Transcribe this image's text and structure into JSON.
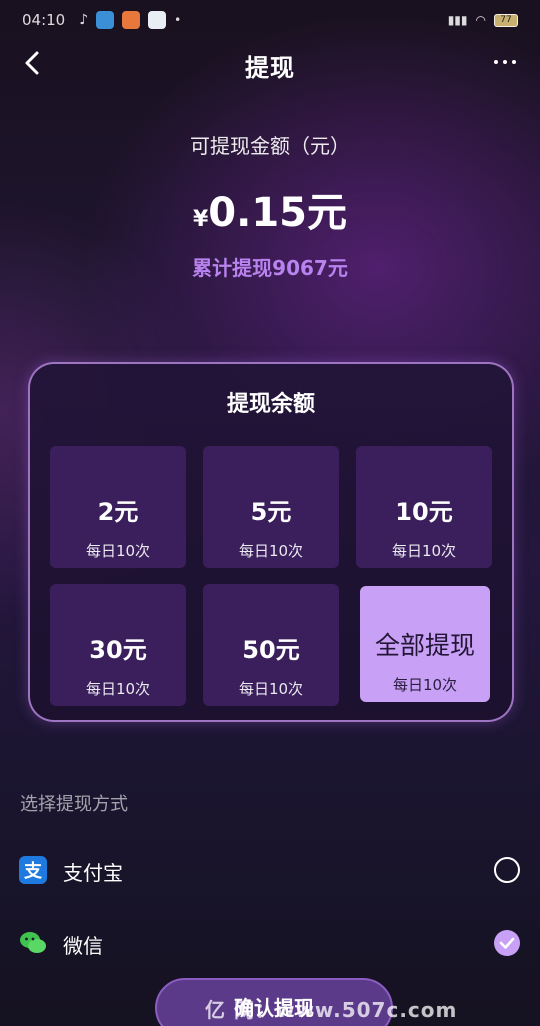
{
  "status_bar": {
    "time": "04:10",
    "battery": "77"
  },
  "nav": {
    "title": "提现"
  },
  "balance": {
    "label": "可提现金额（元）",
    "currency": "¥",
    "amount": "0.15元",
    "total_withdrawn": "累计提现9067元"
  },
  "card": {
    "title": "提现余额",
    "options": [
      {
        "amount": "2元",
        "limit": "每日10次"
      },
      {
        "amount": "5元",
        "limit": "每日10次"
      },
      {
        "amount": "10元",
        "limit": "每日10次"
      },
      {
        "amount": "30元",
        "limit": "每日10次"
      },
      {
        "amount": "50元",
        "limit": "每日10次"
      },
      {
        "amount": "全部提现",
        "limit": "每日10次"
      }
    ]
  },
  "methods": {
    "header": "选择提现方式",
    "items": [
      {
        "label": "支付宝",
        "checked": false
      },
      {
        "label": "微信",
        "checked": true
      }
    ]
  },
  "confirm": {
    "label": "确认提现"
  },
  "watermark": {
    "text": "亿  网：www.507c.com"
  },
  "colors": {
    "accent": "#c8a0f5",
    "highlight_text": "#b983ef",
    "option_bg": "#3a1f5c"
  }
}
